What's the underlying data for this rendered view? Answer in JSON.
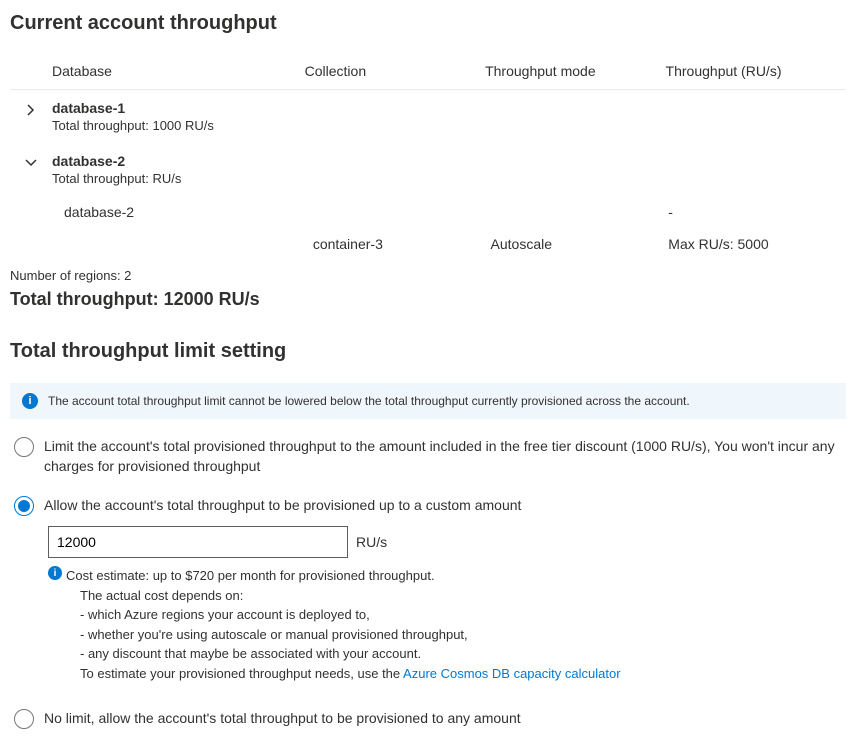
{
  "section1": {
    "title": "Current account throughput"
  },
  "table": {
    "headers": {
      "database": "Database",
      "collection": "Collection",
      "mode": "Throughput mode",
      "throughput": "Throughput (RU/s)"
    }
  },
  "db1": {
    "name": "database-1",
    "sub": "Total throughput: 1000 RU/s"
  },
  "db2": {
    "name": "database-2",
    "sub": "Total throughput: RU/s"
  },
  "db2row1": {
    "database": "database-2",
    "throughput": "-"
  },
  "db2row2": {
    "collection": "container-3",
    "mode": "Autoscale",
    "throughput": "Max RU/s: 5000"
  },
  "regions": {
    "label": "Number of regions: 2"
  },
  "total": {
    "label": "Total throughput: 12000 RU/s"
  },
  "section2": {
    "title": "Total throughput limit setting"
  },
  "banner": {
    "text": "The account total throughput limit cannot be lowered below the total throughput currently provisioned across the account."
  },
  "option1": {
    "label": "Limit the account's total provisioned throughput to the amount included in the free tier discount (1000 RU/s), You won't incur any charges for provisioned throughput"
  },
  "option2": {
    "label": "Allow the account's total throughput to be provisioned up to a custom amount",
    "value": "12000",
    "unit": "RU/s"
  },
  "cost": {
    "line1": "Cost estimate: up to $720 per month for provisioned throughput.",
    "line2": "The actual cost depends on:",
    "line3": "- which Azure regions your account is deployed to,",
    "line4": "- whether you're using autoscale or manual provisioned throughput,",
    "line5": "- any discount that maybe be associated with your account.",
    "line6": "To estimate your provisioned throughput needs, use the ",
    "link": "Azure Cosmos DB capacity calculator"
  },
  "option3": {
    "label": "No limit, allow the account's total throughput to be provisioned to any amount"
  }
}
